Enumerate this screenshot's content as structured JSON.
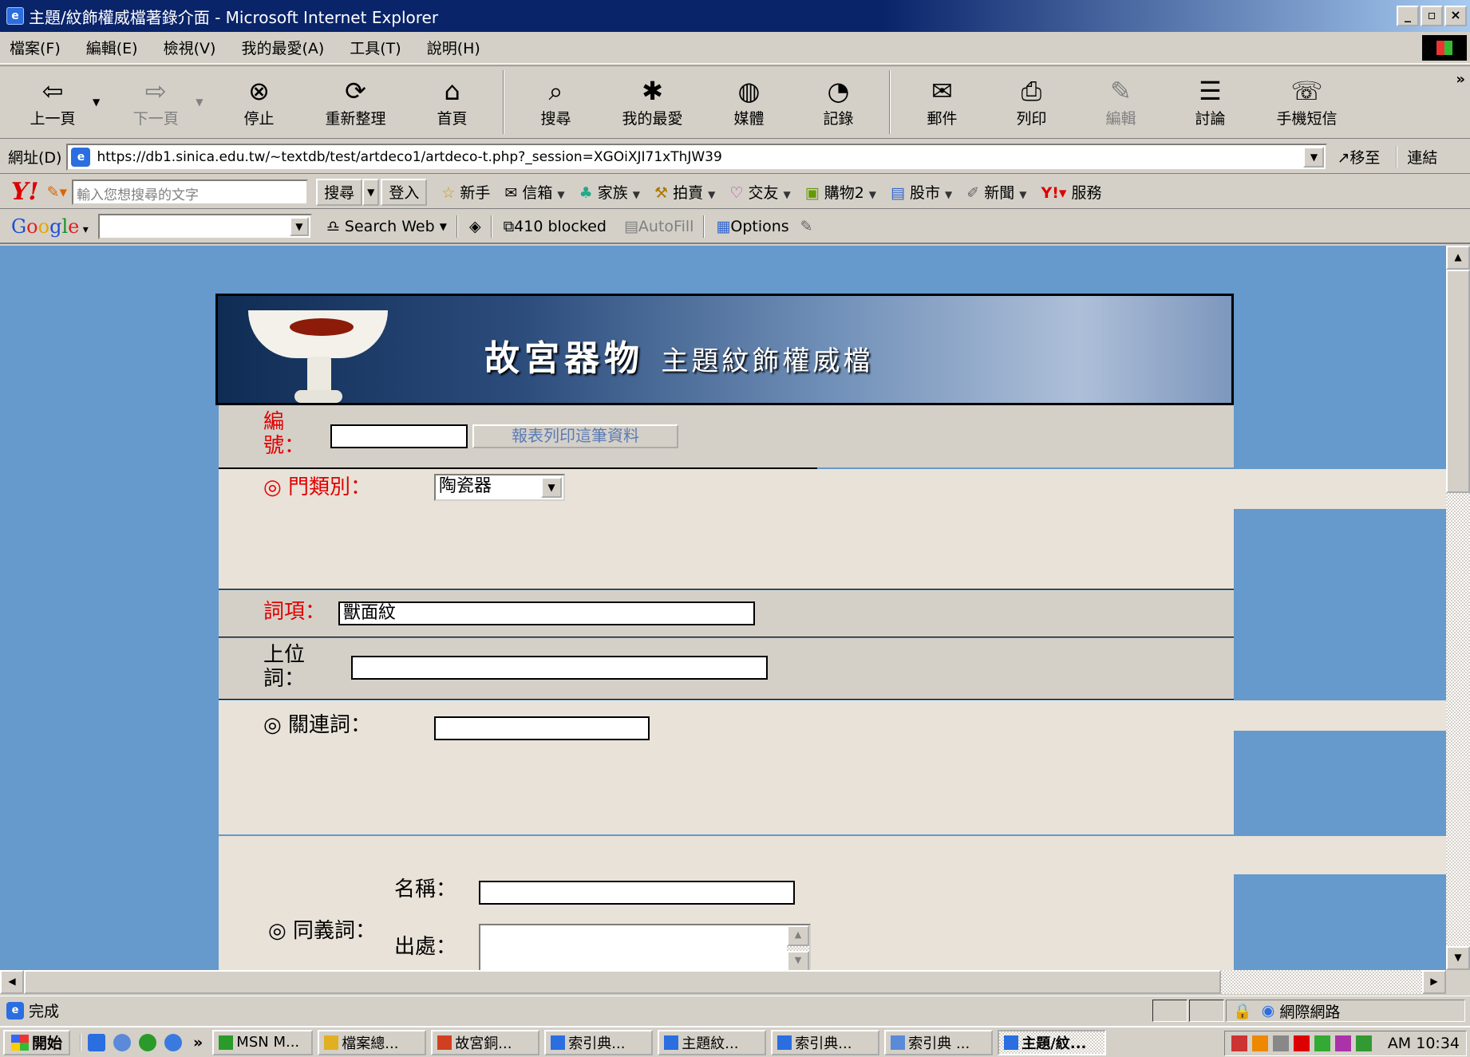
{
  "window": {
    "title": "主題/紋飾權威檔著錄介面 - Microsoft Internet Explorer",
    "buttons": [
      "_",
      "▫",
      "×"
    ]
  },
  "menu": [
    "檔案(F)",
    "編輯(E)",
    "檢視(V)",
    "我的最愛(A)",
    "工具(T)",
    "說明(H)"
  ],
  "toolbar": {
    "back": "上一頁",
    "forward": "下一頁",
    "stop": "停止",
    "refresh": "重新整理",
    "home": "首頁",
    "search": "搜尋",
    "favorites": "我的最愛",
    "media": "媒體",
    "history": "記錄",
    "mail": "郵件",
    "print": "列印",
    "edit": "編輯",
    "discuss": "討論",
    "sms": "手機短信",
    "more": "»"
  },
  "address": {
    "label": "網址(D)",
    "url": "https://db1.sinica.edu.tw/~textdb/test/artdeco1/artdeco-t.php?_session=XGOiXJI71xThJW39",
    "go": "移至",
    "links": "連結"
  },
  "yahoo": {
    "logo": "Y!",
    "placeholder": "輸入您想搜尋的文字",
    "search": "搜尋",
    "login": "登入",
    "links": [
      "新手",
      "信箱",
      "家族",
      "拍賣",
      "交友",
      "購物2",
      "股市",
      "新聞",
      "服務"
    ]
  },
  "google": {
    "search_web": "Search Web",
    "blocked": "410 blocked",
    "autofill": "AutoFill",
    "options": "Options"
  },
  "page": {
    "banner_title": "故宮器物",
    "banner_subtitle": "主題紋飾權威檔",
    "number_label": "編號：",
    "number_value": "",
    "print_button": "報表列印這筆資料",
    "category_label": "◎ 門類別：",
    "category_value": "陶瓷器",
    "term_label": "詞項：",
    "term_value": "獸面紋",
    "broader_label": "上位詞：",
    "broader_value": "",
    "related_label": "◎ 關連詞：",
    "related_value": "",
    "synonym_label": "◎ 同義詞：",
    "syn_name_label": "名稱：",
    "syn_name_value": "",
    "syn_source_label": "出處：",
    "syn_source_value": ""
  },
  "status": {
    "text": "完成",
    "zone": "網際網路"
  },
  "taskbar": {
    "start": "開始",
    "expand": "»",
    "tasks": [
      "MSN M...",
      "檔案總...",
      "故宮銅...",
      "索引典...",
      "主題紋...",
      "索引典...",
      "索引典 ...",
      "主題/紋..."
    ],
    "clock": "AM 10:34"
  }
}
